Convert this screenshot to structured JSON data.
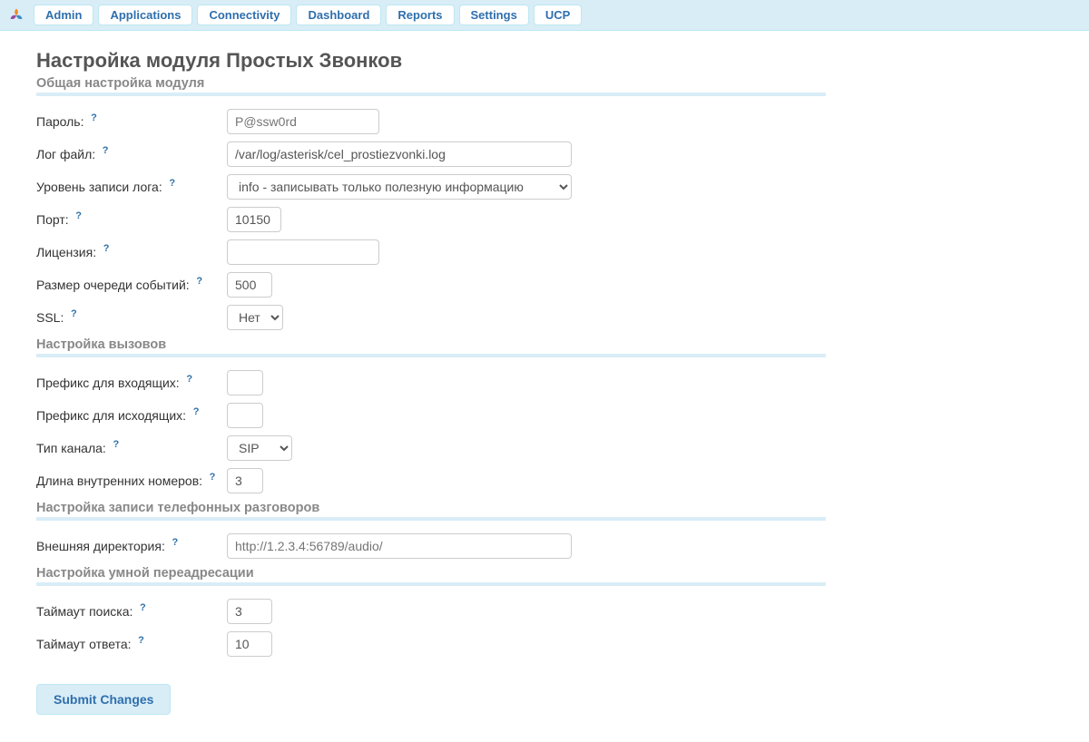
{
  "nav": {
    "items": [
      "Admin",
      "Applications",
      "Connectivity",
      "Dashboard",
      "Reports",
      "Settings",
      "UCP"
    ]
  },
  "page_title": "Настройка модуля Простых Звонков",
  "sections": {
    "general": {
      "title": "Общая настройка модуля",
      "password_label": "Пароль:",
      "password_placeholder": "P@ssw0rd",
      "password_value": "",
      "logfile_label": "Лог файл:",
      "logfile_value": "/var/log/asterisk/cel_prostiezvonki.log",
      "loglevel_label": "Уровень записи лога:",
      "loglevel_value": "info - записывать только полезную информацию",
      "loglevel_options": [
        "info - записывать только полезную информацию"
      ],
      "port_label": "Порт:",
      "port_value": "10150",
      "license_label": "Лицензия:",
      "license_value": "",
      "queue_label": "Размер очереди событий:",
      "queue_value": "500",
      "ssl_label": "SSL:",
      "ssl_value": "Нет",
      "ssl_options": [
        "Нет"
      ]
    },
    "calls": {
      "title": "Настройка вызовов",
      "incoming_prefix_label": "Префикс для входящих:",
      "incoming_prefix_value": "",
      "outgoing_prefix_label": "Префикс для исходящих:",
      "outgoing_prefix_value": "",
      "channel_label": "Тип канала:",
      "channel_value": "SIP",
      "channel_options": [
        "SIP"
      ],
      "ext_len_label": "Длина внутренних номеров:",
      "ext_len_value": "3"
    },
    "recording": {
      "title": "Настройка записи телефонных разговоров",
      "extdir_label": "Внешняя директория:",
      "extdir_placeholder": "http://1.2.3.4:56789/audio/",
      "extdir_value": ""
    },
    "smart": {
      "title": "Настройка умной переадресации",
      "search_timeout_label": "Таймаут поиска:",
      "search_timeout_value": "3",
      "answer_timeout_label": "Таймаут ответа:",
      "answer_timeout_value": "10"
    }
  },
  "submit_label": "Submit Changes"
}
